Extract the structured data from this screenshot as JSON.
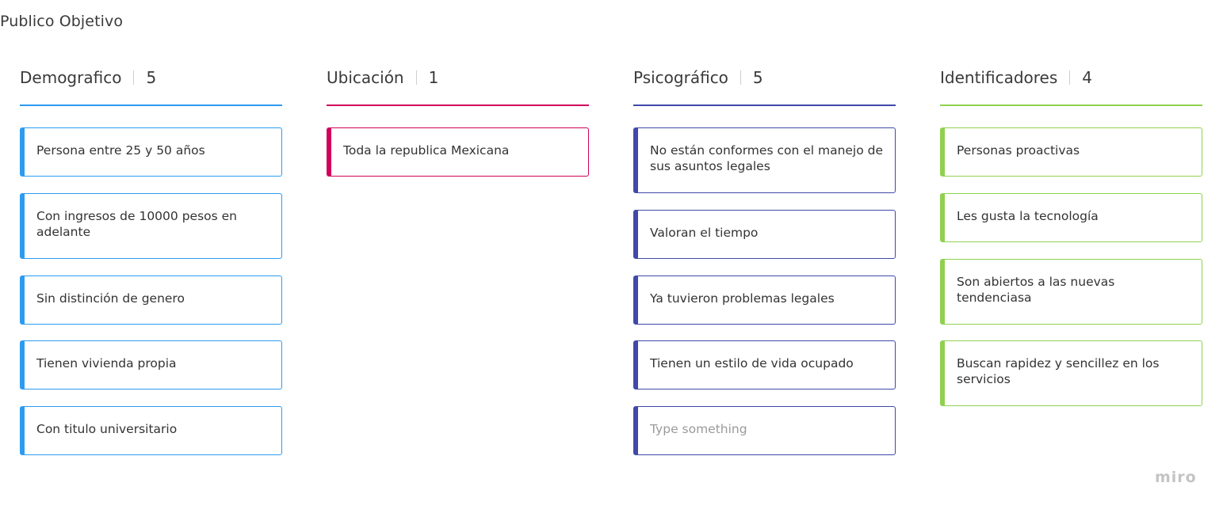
{
  "board": {
    "title": "Publico Objetivo"
  },
  "columns": [
    {
      "name": "Demografico",
      "count": "5",
      "accent": "#2d9bf0",
      "cards": [
        {
          "text": "Persona entre 25 y 50 años"
        },
        {
          "text": "Con ingresos de 10000 pesos en adelante"
        },
        {
          "text": "Sin distinción de genero"
        },
        {
          "text": "Tienen vivienda propia"
        },
        {
          "text": "Con titulo universitario"
        }
      ]
    },
    {
      "name": "Ubicación",
      "count": "1",
      "accent": "#d1005c",
      "cards": [
        {
          "text": "Toda la republica Mexicana"
        }
      ]
    },
    {
      "name": "Psicográfico",
      "count": "5",
      "accent": "#4049a9",
      "cards": [
        {
          "text": "No están conformes con el manejo de sus asuntos legales"
        },
        {
          "text": "Valoran el tiempo"
        },
        {
          "text": "Ya tuvieron problemas legales"
        },
        {
          "text": "Tienen un estilo de vida ocupado"
        },
        {
          "text": "",
          "placeholder": "Type something"
        }
      ]
    },
    {
      "name": "Identificadores",
      "count": "4",
      "accent": "#8fd14f",
      "cards": [
        {
          "text": "Personas proactivas"
        },
        {
          "text": "Les gusta la tecnología"
        },
        {
          "text": "Son abiertos a las nuevas tendenciasa"
        },
        {
          "text": "Buscan rapidez y sencillez en los servicios"
        }
      ]
    }
  ],
  "branding": {
    "logo_text": "miro"
  }
}
